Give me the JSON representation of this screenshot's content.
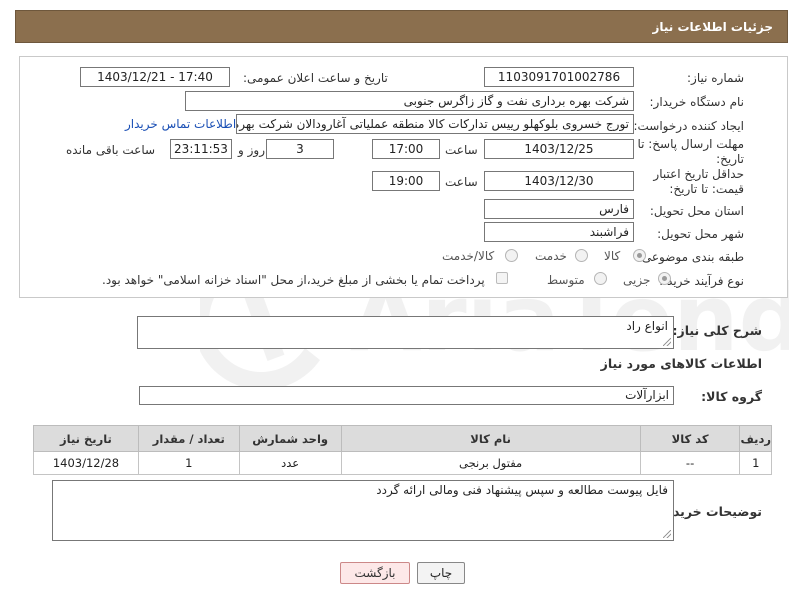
{
  "header": {
    "title": "جزئیات اطلاعات نیاز"
  },
  "form": {
    "need_number_label": "شماره نیاز:",
    "need_number": "1103091701002786",
    "announce_label": "تاریخ و ساعت اعلان عمومی:",
    "announce_value": "1403/12/21 - 17:40",
    "buyer_org_label": "نام دستگاه خریدار:",
    "buyer_org": "شرکت بهره برداری نفت و گاز زاگرس جنوبی",
    "creator_label": "ایجاد کننده درخواست:",
    "creator": "تورج خسروی بلوکهلو رییس تدارکات کالا منطقه عملیاتی آغارودالان شرکت بهره برداری",
    "contact_link": "اطلاعات تماس خریدار",
    "reply_deadline_label": "مهلت ارسال پاسخ: تا تاریخ:",
    "reply_date": "1403/12/25",
    "time_label": "ساعت",
    "reply_time": "17:00",
    "days_value": "3",
    "days_label": "روز و",
    "remaining_time": "23:11:53",
    "remaining_label": "ساعت باقی مانده",
    "price_validity_label": "حداقل تاریخ اعتبار قیمت: تا تاریخ:",
    "validity_date": "1403/12/30",
    "validity_time_label": "ساعت",
    "validity_time": "19:00",
    "province_label": "استان محل تحویل:",
    "province": "فارس",
    "city_label": "شهر محل تحویل:",
    "city": "فراشبند",
    "category_label": "طبقه بندی موضوعی:",
    "category_options": [
      "کالا",
      "خدمت",
      "کالا/خدمت"
    ],
    "process_label": "نوع فرآیند خرید :",
    "process_options": [
      "جزیی",
      "متوسط"
    ],
    "payment_note": "پرداخت تمام یا بخشی از مبلغ خرید،از محل \"اسناد خزانه اسلامی\" خواهد بود."
  },
  "description": {
    "label": "شرح کلی نیاز:",
    "value": "انواع راد"
  },
  "goods_info_title": "اطلاعات کالاهای مورد نیاز",
  "goods_group": {
    "label": "گروه کالا:",
    "value": "ابزارآلات"
  },
  "table": {
    "headers": [
      "ردیف",
      "کد کالا",
      "نام کالا",
      "واحد شمارش",
      "تعداد / مقدار",
      "تاریخ نیاز"
    ],
    "rows": [
      [
        "1",
        "--",
        "مفتول برنجی",
        "عدد",
        "1",
        "1403/12/28"
      ]
    ]
  },
  "buyer_notes": {
    "label": "توضیحات خریدار:",
    "value": "فایل پیوست مطالعه و سپس پیشنهاد فنی ومالی ارائه گردد"
  },
  "buttons": {
    "print": "چاپ",
    "back": "بازگشت"
  },
  "watermark_text": "AriaTender.neT"
}
